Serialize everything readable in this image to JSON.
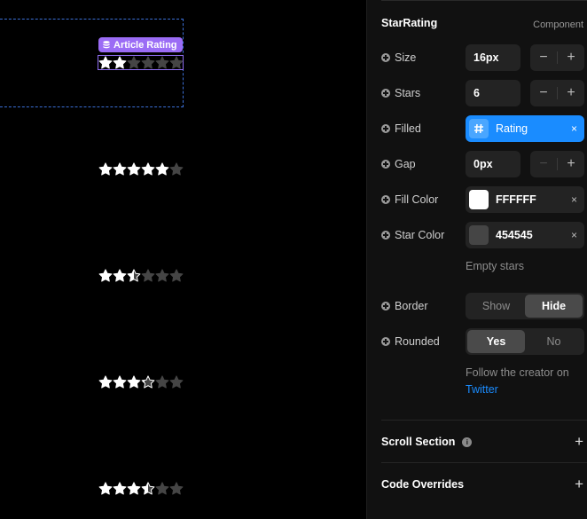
{
  "canvas": {
    "layer_badge": "Article Rating",
    "star_rows": [
      {
        "filled": 2,
        "partial": 0,
        "total": 6
      },
      {
        "filled": 5,
        "partial": 0,
        "total": 6
      },
      {
        "filled": 2,
        "partial": 0.5,
        "total": 6
      },
      {
        "filled": 3,
        "partial": 0.2,
        "total": 6
      },
      {
        "filled": 3,
        "partial": 0.5,
        "total": 6
      }
    ],
    "fill_color": "#FFFFFF",
    "empty_color": "#454545"
  },
  "panel": {
    "component_name": "StarRating",
    "component_type": "Component",
    "size": {
      "label": "Size",
      "value": "16px"
    },
    "stars": {
      "label": "Stars",
      "value": "6"
    },
    "filled": {
      "label": "Filled",
      "value": "Rating"
    },
    "gap": {
      "label": "Gap",
      "value": "0px"
    },
    "fill_color": {
      "label": "Fill Color",
      "value": "FFFFFF",
      "swatch": "#FFFFFF"
    },
    "star_color": {
      "label": "Star Color",
      "value": "454545",
      "swatch": "#454545",
      "hint": "Empty stars"
    },
    "border": {
      "label": "Border",
      "options": [
        "Show",
        "Hide"
      ],
      "selected": "Hide"
    },
    "rounded": {
      "label": "Rounded",
      "options": [
        "Yes",
        "No"
      ],
      "selected": "Yes"
    },
    "creator_text": "Follow the creator on",
    "creator_link": "Twitter",
    "sections": [
      {
        "label": "Scroll Section",
        "has_info": true
      },
      {
        "label": "Code Overrides",
        "has_info": false
      }
    ],
    "symbols": {
      "minus": "−",
      "plus": "+",
      "close": "×",
      "info": "i"
    }
  }
}
